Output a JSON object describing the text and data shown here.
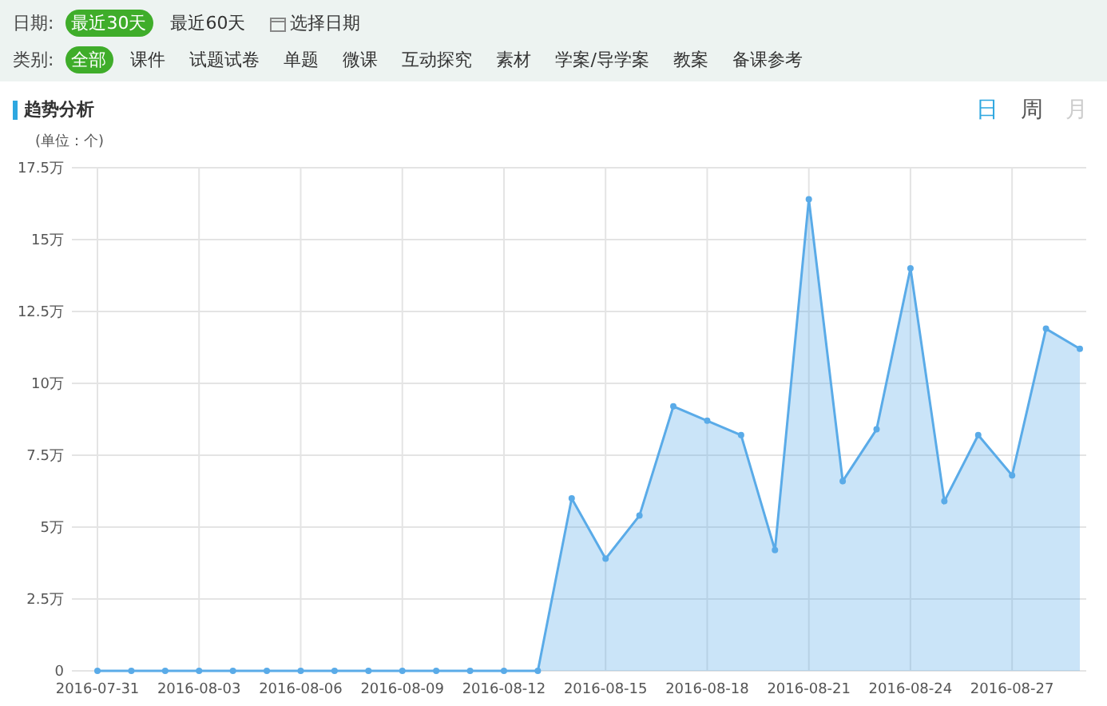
{
  "filters": [
    {
      "label": "日期:",
      "options": [
        {
          "text": "最近30天",
          "selected": true,
          "kind": "text"
        },
        {
          "text": "最近60天",
          "selected": false,
          "kind": "text"
        },
        {
          "text": "选择日期",
          "selected": false,
          "kind": "date"
        }
      ]
    },
    {
      "label": "类别:",
      "options": [
        {
          "text": "全部",
          "selected": true,
          "kind": "text"
        },
        {
          "text": "课件",
          "selected": false,
          "kind": "text"
        },
        {
          "text": "试题试卷",
          "selected": false,
          "kind": "text"
        },
        {
          "text": "单题",
          "selected": false,
          "kind": "text"
        },
        {
          "text": "微课",
          "selected": false,
          "kind": "text"
        },
        {
          "text": "互动探究",
          "selected": false,
          "kind": "text"
        },
        {
          "text": "素材",
          "selected": false,
          "kind": "text"
        },
        {
          "text": "学案/导学案",
          "selected": false,
          "kind": "text"
        },
        {
          "text": "教案",
          "selected": false,
          "kind": "text"
        },
        {
          "text": "备课参考",
          "selected": false,
          "kind": "text"
        }
      ]
    }
  ],
  "section": {
    "title": "趋势分析",
    "periods": [
      {
        "label": "日",
        "selected": true,
        "disabled": false
      },
      {
        "label": "周",
        "selected": false,
        "disabled": false
      },
      {
        "label": "月",
        "selected": false,
        "disabled": true
      }
    ]
  },
  "chart": {
    "unit": "(单位：个)",
    "chart_data": {
      "type": "area",
      "categories": [
        "2016-07-31",
        null,
        null,
        "2016-08-03",
        null,
        null,
        "2016-08-06",
        null,
        null,
        "2016-08-09",
        null,
        null,
        "2016-08-12",
        null,
        null,
        "2016-08-15",
        null,
        null,
        "2016-08-18",
        null,
        null,
        "2016-08-21",
        null,
        null,
        "2016-08-24",
        null,
        null,
        "2016-08-27",
        null,
        null
      ],
      "series": [
        {
          "color": "#5aabe8",
          "values": [
            0,
            0,
            0,
            0,
            0,
            0,
            0,
            0,
            0,
            0,
            0,
            0,
            0,
            0,
            6.0,
            3.9,
            5.4,
            9.2,
            8.7,
            8.2,
            4.2,
            16.4,
            6.6,
            8.4,
            14.0,
            5.9,
            8.2,
            6.8,
            11.9,
            11.2
          ]
        }
      ],
      "ylim": [
        0,
        17.5
      ],
      "grid": true,
      "yticks": [
        {
          "value": 0,
          "label": "0"
        },
        {
          "value": 2.5,
          "label": "2.5万"
        },
        {
          "value": 5,
          "label": "5万"
        },
        {
          "value": 7.5,
          "label": "7.5万"
        },
        {
          "value": 10,
          "label": "10万"
        },
        {
          "value": 12.5,
          "label": "12.5万"
        },
        {
          "value": 15,
          "label": "15万"
        },
        {
          "value": 17.5,
          "label": "17.5万"
        }
      ]
    }
  }
}
